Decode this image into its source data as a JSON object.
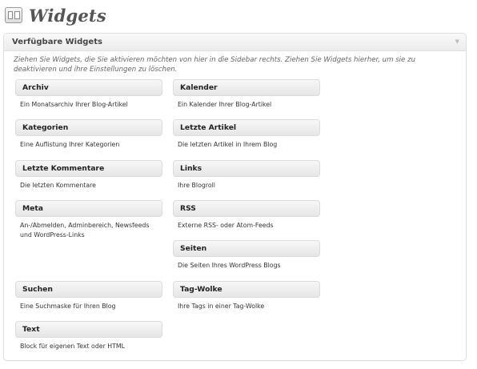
{
  "header": {
    "title": "Widgets",
    "icon": "widgets-icon"
  },
  "panel": {
    "title": "Verfügbare Widgets",
    "toggle_glyph": "▼",
    "description": "Ziehen Sie Widgets, die Sie aktivieren möchten von hier in die Sidebar rechts. Ziehen Sie Widgets hierher, um sie zu deaktivieren und ihre Einstellungen zu löschen."
  },
  "widgets": {
    "archiv": {
      "name": "Archiv",
      "desc": "Ein Monatsarchiv Ihrer Blog-Artikel"
    },
    "kalender": {
      "name": "Kalender",
      "desc": "Ein Kalender Ihrer Blog-Artikel"
    },
    "kategorien": {
      "name": "Kategorien",
      "desc": "Eine Auflistung Ihrer Kategorien"
    },
    "letzte_artikel": {
      "name": "Letzte Artikel",
      "desc": "Die letzten Artikel in Ihrem Blog"
    },
    "letzte_kommentare": {
      "name": "Letzte Kommentare",
      "desc": "Die letzten Kommentare"
    },
    "links": {
      "name": "Links",
      "desc": "Ihre Blogroll"
    },
    "meta": {
      "name": "Meta",
      "desc": "An-/Abmelden, Adminbereich, Newsfeeds und WordPress-Links"
    },
    "rss": {
      "name": "RSS",
      "desc": "Externe RSS- oder Atom-Feeds"
    },
    "seiten": {
      "name": "Seiten",
      "desc": "Die Seiten Ihres WordPress Blogs"
    },
    "suchen": {
      "name": "Suchen",
      "desc": "Eine Suchmaske für Ihren Blog"
    },
    "tag_wolke": {
      "name": "Tag-Wolke",
      "desc": "Ihre Tags in einer Tag-Wolke"
    },
    "text": {
      "name": "Text",
      "desc": "Block für eigenen Text oder HTML"
    }
  }
}
